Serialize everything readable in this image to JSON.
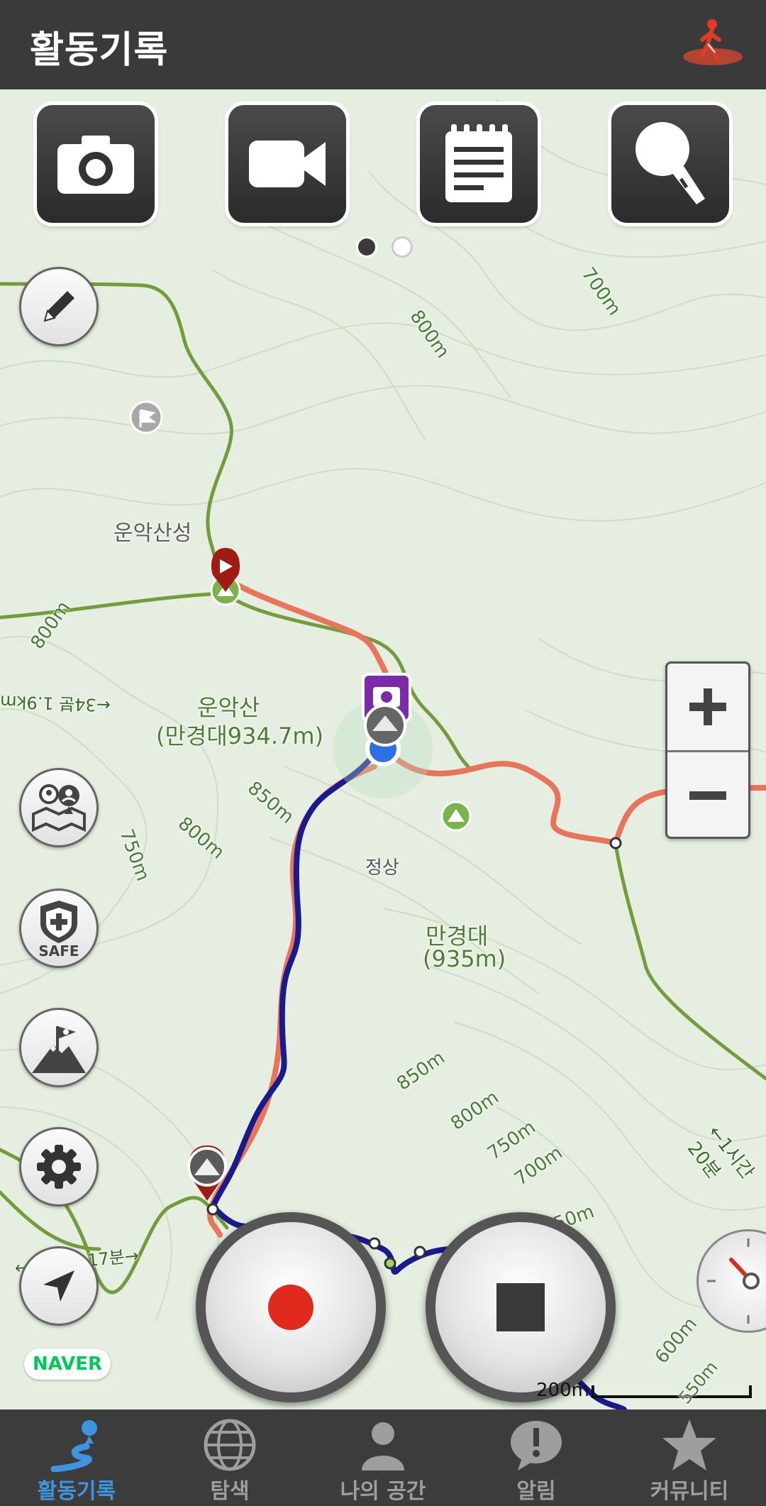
{
  "header": {
    "title": "활동기록",
    "icon": "hiker-icon"
  },
  "media_buttons": [
    {
      "name": "camera-button",
      "icon": "camera-icon"
    },
    {
      "name": "video-button",
      "icon": "video-camera-icon"
    },
    {
      "name": "memo-button",
      "icon": "notepad-icon"
    },
    {
      "name": "voice-button",
      "icon": "microphone-icon"
    }
  ],
  "pager": {
    "count": 2,
    "active": 0
  },
  "map": {
    "labels": {
      "fortress": "운악산성",
      "mountain_name": "운악산",
      "mountain_sub": "(만경대934.7m)",
      "summit": "정상",
      "peak_name": "만경대",
      "peak_sub": "(935m)",
      "c800a": "800m",
      "c700a": "700m",
      "c800b": "800m",
      "c850a": "850m",
      "c800c": "800m",
      "c750a": "750m",
      "c850b": "850m",
      "c800d": "800m",
      "c750b": "750m",
      "c700b": "700m",
      "c650": "650m",
      "c600": "600m",
      "c550": "550m",
      "trail_a": "←1시간20분",
      "trail_b": "←34분 1.9km",
      "trail_c": "←2 8km 17분→"
    },
    "provider": "NAVER",
    "scale": "200m",
    "route_color": "#1a1a8c",
    "trail_color": "#e8745c",
    "path_color": "#6f9a3e"
  },
  "controls": {
    "zoom_in": "+",
    "zoom_out": "−",
    "side": [
      {
        "name": "edit-button",
        "icon": "pencil-icon"
      },
      {
        "name": "nearby-users-button",
        "icon": "map-people-icon"
      },
      {
        "name": "safe-button",
        "icon": "shield-icon",
        "label": "SAFE"
      },
      {
        "name": "summit-button",
        "icon": "mountain-flag-icon"
      },
      {
        "name": "settings-button",
        "icon": "gear-icon"
      },
      {
        "name": "locate-button",
        "icon": "location-arrow-icon"
      }
    ]
  },
  "tabs": [
    {
      "label": "활동기록",
      "icon": "route-pin-icon",
      "active": true
    },
    {
      "label": "탐색",
      "icon": "globe-icon",
      "active": false
    },
    {
      "label": "나의 공간",
      "icon": "person-icon",
      "active": false
    },
    {
      "label": "알림",
      "icon": "alert-bubble-icon",
      "active": false
    },
    {
      "label": "커뮤니티",
      "icon": "star-icon",
      "active": false
    }
  ]
}
